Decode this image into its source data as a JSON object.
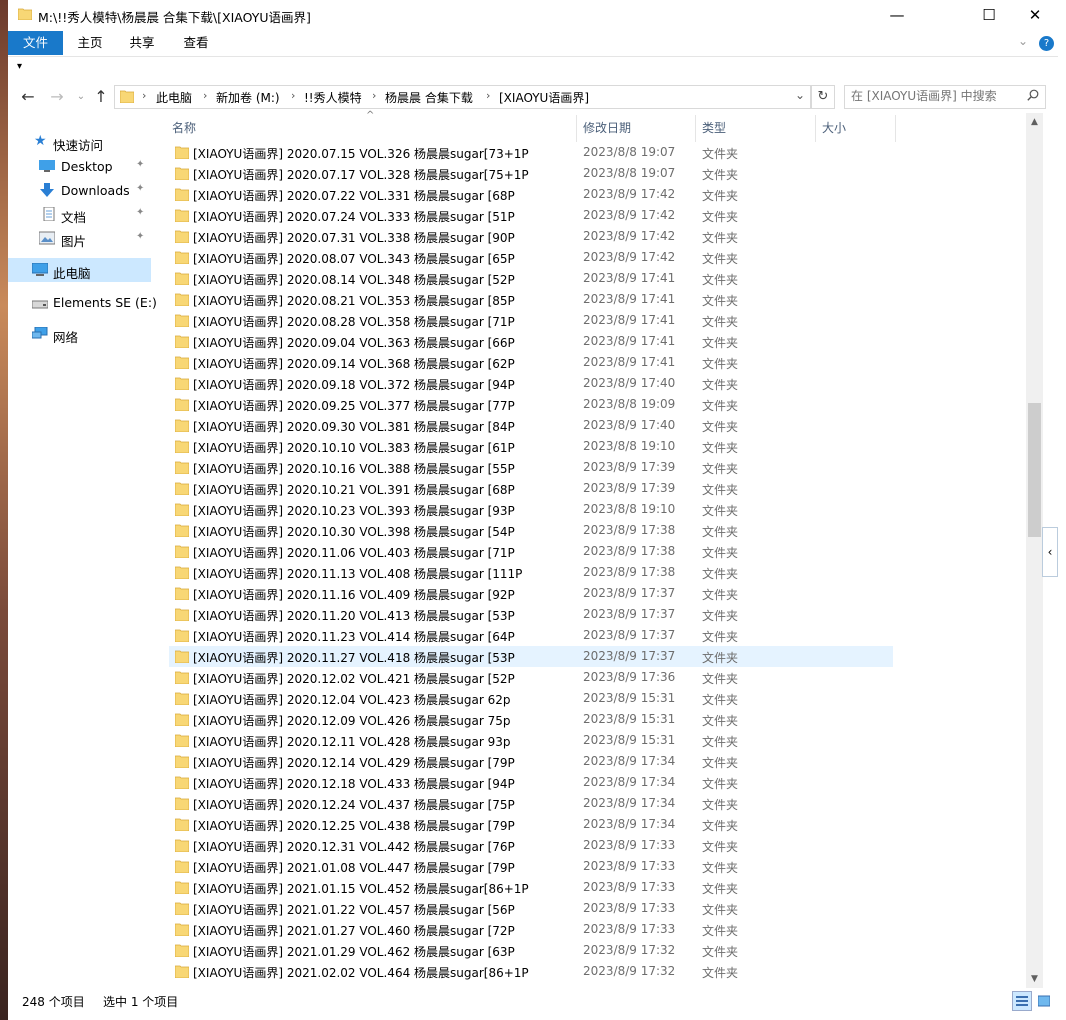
{
  "window": {
    "title": "M:\\!!秀人模特\\杨晨晨 合集下载\\[XIAOYU语画界]",
    "controls": {
      "minimize": "—",
      "maximize": "☐",
      "close": "✕"
    }
  },
  "ribbon": {
    "tabs": [
      "文件",
      "主页",
      "共享",
      "查看"
    ],
    "expand_glyph": "⌄",
    "help_glyph": "?"
  },
  "quick_access_glyph": "▾",
  "address": {
    "segments": [
      "此电脑",
      "新加卷 (M:)",
      "!!秀人模特",
      "杨晨晨 合集下载",
      "[XIAOYU语画界]"
    ],
    "separator": "›",
    "dropdown_glyph": "⌄",
    "refresh_glyph": "↻",
    "search_placeholder": "在 [XIAOYU语画界] 中搜索"
  },
  "nav": {
    "back": "←",
    "forward": "→",
    "recent": "⌄",
    "up": "↑",
    "items": [
      {
        "label": "快速访问",
        "icon": "star-icon"
      },
      {
        "label": "Desktop",
        "icon": "desktop-icon",
        "pinned": true
      },
      {
        "label": "Downloads",
        "icon": "download-icon",
        "pinned": true
      },
      {
        "label": "文档",
        "icon": "document-icon",
        "pinned": true
      },
      {
        "label": "图片",
        "icon": "pictures-icon",
        "pinned": true
      },
      {
        "label": "此电脑",
        "icon": "computer-icon",
        "selected": true
      },
      {
        "label": "Elements SE (E:)",
        "icon": "drive-icon"
      },
      {
        "label": "网络",
        "icon": "network-icon"
      }
    ],
    "pin_glyph": "📌"
  },
  "columns": {
    "name": "名称",
    "date": "修改日期",
    "type": "类型",
    "size": "大小"
  },
  "files": [
    {
      "name": "[XIAOYU语画界] 2020.07.15 VOL.326 杨晨晨sugar[73+1P",
      "date": "2023/8/8 19:07",
      "type": "文件夹"
    },
    {
      "name": "[XIAOYU语画界] 2020.07.17 VOL.328 杨晨晨sugar[75+1P",
      "date": "2023/8/8 19:07",
      "type": "文件夹"
    },
    {
      "name": "[XIAOYU语画界] 2020.07.22 VOL.331 杨晨晨sugar [68P",
      "date": "2023/8/9 17:42",
      "type": "文件夹"
    },
    {
      "name": "[XIAOYU语画界] 2020.07.24 VOL.333 杨晨晨sugar [51P",
      "date": "2023/8/9 17:42",
      "type": "文件夹"
    },
    {
      "name": "[XIAOYU语画界] 2020.07.31 VOL.338 杨晨晨sugar [90P",
      "date": "2023/8/9 17:42",
      "type": "文件夹"
    },
    {
      "name": "[XIAOYU语画界] 2020.08.07 VOL.343 杨晨晨sugar [65P",
      "date": "2023/8/9 17:42",
      "type": "文件夹"
    },
    {
      "name": "[XIAOYU语画界] 2020.08.14 VOL.348 杨晨晨sugar [52P",
      "date": "2023/8/9 17:41",
      "type": "文件夹"
    },
    {
      "name": "[XIAOYU语画界] 2020.08.21 VOL.353 杨晨晨sugar [85P",
      "date": "2023/8/9 17:41",
      "type": "文件夹"
    },
    {
      "name": "[XIAOYU语画界] 2020.08.28 VOL.358 杨晨晨sugar [71P",
      "date": "2023/8/9 17:41",
      "type": "文件夹"
    },
    {
      "name": "[XIAOYU语画界] 2020.09.04 VOL.363 杨晨晨sugar [66P",
      "date": "2023/8/9 17:41",
      "type": "文件夹"
    },
    {
      "name": "[XIAOYU语画界] 2020.09.14 VOL.368 杨晨晨sugar [62P",
      "date": "2023/8/9 17:41",
      "type": "文件夹"
    },
    {
      "name": "[XIAOYU语画界] 2020.09.18 VOL.372 杨晨晨sugar [94P",
      "date": "2023/8/9 17:40",
      "type": "文件夹"
    },
    {
      "name": "[XIAOYU语画界] 2020.09.25 VOL.377 杨晨晨sugar [77P",
      "date": "2023/8/8 19:09",
      "type": "文件夹"
    },
    {
      "name": "[XIAOYU语画界] 2020.09.30 VOL.381 杨晨晨sugar [84P",
      "date": "2023/8/9 17:40",
      "type": "文件夹"
    },
    {
      "name": "[XIAOYU语画界] 2020.10.10 VOL.383 杨晨晨sugar [61P",
      "date": "2023/8/8 19:10",
      "type": "文件夹"
    },
    {
      "name": "[XIAOYU语画界] 2020.10.16 VOL.388 杨晨晨sugar [55P",
      "date": "2023/8/9 17:39",
      "type": "文件夹"
    },
    {
      "name": "[XIAOYU语画界] 2020.10.21 VOL.391 杨晨晨sugar [68P",
      "date": "2023/8/9 17:39",
      "type": "文件夹"
    },
    {
      "name": "[XIAOYU语画界] 2020.10.23 VOL.393 杨晨晨sugar [93P",
      "date": "2023/8/8 19:10",
      "type": "文件夹"
    },
    {
      "name": "[XIAOYU语画界] 2020.10.30 VOL.398 杨晨晨sugar [54P",
      "date": "2023/8/9 17:38",
      "type": "文件夹"
    },
    {
      "name": "[XIAOYU语画界] 2020.11.06 VOL.403 杨晨晨sugar [71P",
      "date": "2023/8/9 17:38",
      "type": "文件夹"
    },
    {
      "name": "[XIAOYU语画界] 2020.11.13 VOL.408 杨晨晨sugar [111P",
      "date": "2023/8/9 17:38",
      "type": "文件夹"
    },
    {
      "name": "[XIAOYU语画界] 2020.11.16 VOL.409 杨晨晨sugar [92P",
      "date": "2023/8/9 17:37",
      "type": "文件夹"
    },
    {
      "name": "[XIAOYU语画界] 2020.11.20 VOL.413 杨晨晨sugar [53P",
      "date": "2023/8/9 17:37",
      "type": "文件夹"
    },
    {
      "name": "[XIAOYU语画界] 2020.11.23 VOL.414 杨晨晨sugar [64P",
      "date": "2023/8/9 17:37",
      "type": "文件夹"
    },
    {
      "name": "[XIAOYU语画界] 2020.11.27 VOL.418 杨晨晨sugar [53P",
      "date": "2023/8/9 17:37",
      "type": "文件夹",
      "selected": true
    },
    {
      "name": "[XIAOYU语画界] 2020.12.02 VOL.421 杨晨晨sugar [52P",
      "date": "2023/8/9 17:36",
      "type": "文件夹"
    },
    {
      "name": "[XIAOYU语画界] 2020.12.04 VOL.423 杨晨晨sugar 62p",
      "date": "2023/8/9 15:31",
      "type": "文件夹"
    },
    {
      "name": "[XIAOYU语画界] 2020.12.09 VOL.426 杨晨晨sugar 75p",
      "date": "2023/8/9 15:31",
      "type": "文件夹"
    },
    {
      "name": "[XIAOYU语画界] 2020.12.11 VOL.428 杨晨晨sugar 93p",
      "date": "2023/8/9 15:31",
      "type": "文件夹"
    },
    {
      "name": "[XIAOYU语画界] 2020.12.14 VOL.429 杨晨晨sugar [79P",
      "date": "2023/8/9 17:34",
      "type": "文件夹"
    },
    {
      "name": "[XIAOYU语画界] 2020.12.18 VOL.433 杨晨晨sugar [94P",
      "date": "2023/8/9 17:34",
      "type": "文件夹"
    },
    {
      "name": "[XIAOYU语画界] 2020.12.24 VOL.437 杨晨晨sugar [75P",
      "date": "2023/8/9 17:34",
      "type": "文件夹"
    },
    {
      "name": "[XIAOYU语画界] 2020.12.25 VOL.438 杨晨晨sugar [79P",
      "date": "2023/8/9 17:34",
      "type": "文件夹"
    },
    {
      "name": "[XIAOYU语画界] 2020.12.31 VOL.442 杨晨晨sugar [76P",
      "date": "2023/8/9 17:33",
      "type": "文件夹"
    },
    {
      "name": "[XIAOYU语画界] 2021.01.08 VOL.447 杨晨晨sugar [79P",
      "date": "2023/8/9 17:33",
      "type": "文件夹"
    },
    {
      "name": "[XIAOYU语画界] 2021.01.15 VOL.452 杨晨晨sugar[86+1P",
      "date": "2023/8/9 17:33",
      "type": "文件夹"
    },
    {
      "name": "[XIAOYU语画界] 2021.01.22 VOL.457 杨晨晨sugar [56P",
      "date": "2023/8/9 17:33",
      "type": "文件夹"
    },
    {
      "name": "[XIAOYU语画界] 2021.01.27 VOL.460 杨晨晨sugar [72P",
      "date": "2023/8/9 17:33",
      "type": "文件夹"
    },
    {
      "name": "[XIAOYU语画界] 2021.01.29 VOL.462 杨晨晨sugar [63P",
      "date": "2023/8/9 17:32",
      "type": "文件夹"
    },
    {
      "name": "[XIAOYU语画界] 2021.02.02 VOL.464 杨晨晨sugar[86+1P",
      "date": "2023/8/9 17:32",
      "type": "文件夹"
    }
  ],
  "status": {
    "count": "248 个项目",
    "selection": "选中 1 个项目"
  },
  "scroll": {
    "up": "▲",
    "down": "▼",
    "side_tab": "‹"
  },
  "colors": {
    "accent": "#1979ca",
    "selected_nav": "#cce8ff",
    "selected_row": "#e5f3ff",
    "folder": "#f8d775"
  }
}
